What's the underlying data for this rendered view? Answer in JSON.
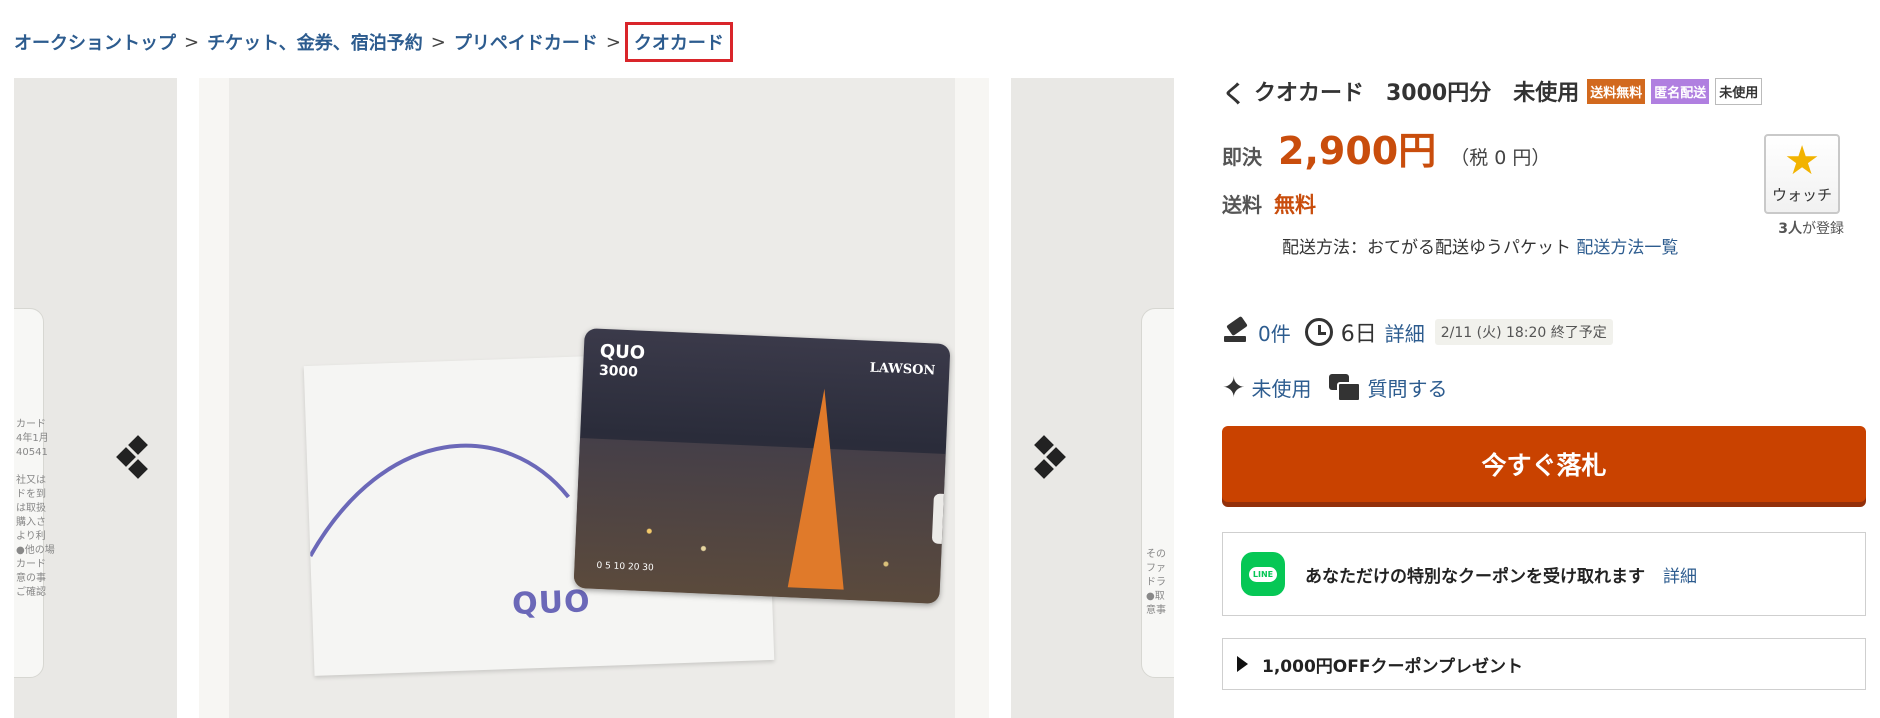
{
  "breadcrumb": {
    "items": [
      "オークショントップ",
      "チケット、金券、宿泊予約",
      "プリペイドカード"
    ],
    "current": "クオカード",
    "separator": ">"
  },
  "gallery": {
    "card_brand": "QUO",
    "card_value": "3000",
    "card_store": "LAWSON",
    "envelope_logo": "QUO",
    "card_scale": "0  5  10  20  30",
    "side_left_text": "カード\n4年1月\n40541\n\n社又は\nドを到\nは取扱\n購入さ\nより利\n●他の場\nカード\n意の事\nご確認",
    "side_right_text": "その\nファ\nドラ\n●取\n意事"
  },
  "product": {
    "back_icon": "く",
    "title": "クオカード　3000円分　未使用",
    "badges": [
      "送料無料",
      "匿名配送",
      "未使用"
    ],
    "price_label": "即決",
    "price": "2,900円",
    "tax": "（税 0 円）",
    "watch_label": "ウォッチ",
    "watch_count_num": "3人",
    "watch_count_suffix": "が登録",
    "shipping_label": "送料",
    "shipping_value": "無料",
    "shipping_method": "配送方法：おてがる配送ゆうパケット",
    "shipping_list_link": "配送方法一覧",
    "bids": "0件",
    "days_left": "6日",
    "detail_link": "詳細",
    "end_time": "2/11 (火) 18:20 終了予定",
    "condition": "未使用",
    "ask_question": "質問する",
    "buy_now_button": "今すぐ落札",
    "line_icon_text": "LINE",
    "line_text": "あなただけの特別なクーポンを受け取れます",
    "line_detail": "詳細",
    "coupon_text": "1,000円OFFクーポンプレゼント"
  },
  "colors": {
    "link": "#2d5c8f",
    "price": "#c94d0c",
    "buy_button": "#c94200",
    "badge_ship": "#d2691e",
    "badge_anon": "#b07fe0",
    "line_green": "#06c755",
    "highlight_box": "#d9252a"
  }
}
